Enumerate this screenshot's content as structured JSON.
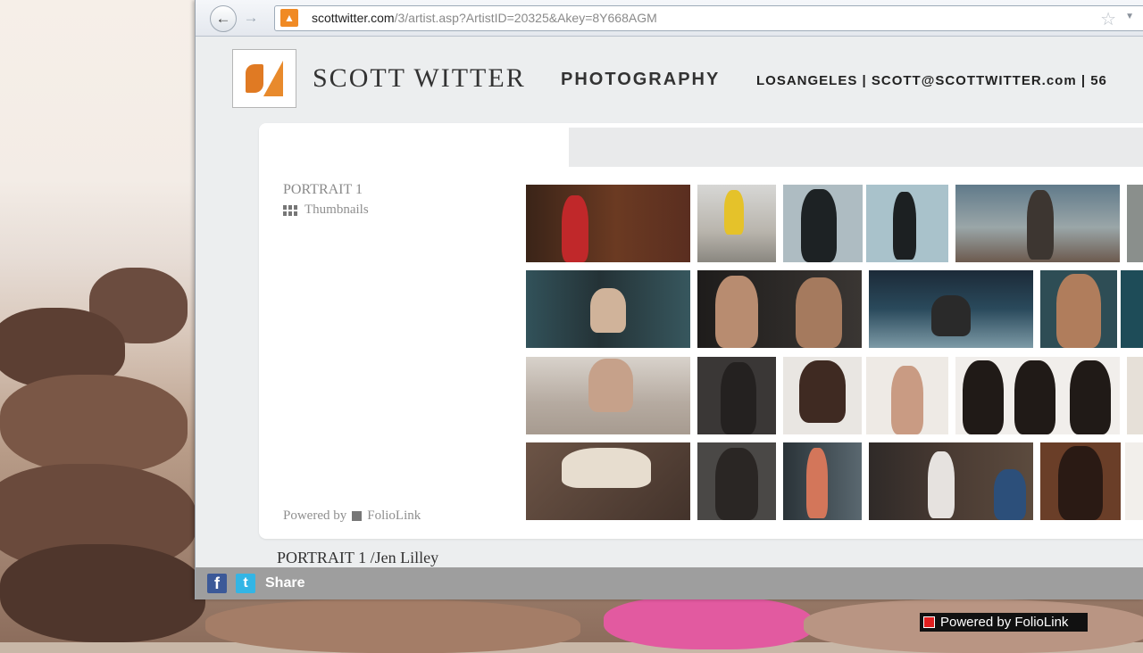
{
  "browser": {
    "url_host": "scottwitter.com",
    "url_path": "/3/artist.asp?ArtistID=20325&Akey=8Y668AGM"
  },
  "header": {
    "title": "SCOTT WITTER",
    "subtitle": "PHOTOGRAPHY",
    "contact": "LOSANGELES | SCOTT@SCOTTWITTER.com | 56"
  },
  "sidebar": {
    "gallery_title": "PORTRAIT 1",
    "thumbnails_label": "Thumbnails",
    "powered_prefix": "Powered by",
    "powered_brand": "FolioLink"
  },
  "caption": "PORTRAIT 1 /Jen Lilley",
  "share": {
    "label": "Share"
  },
  "badge": {
    "text": "Powered by FolioLink"
  },
  "colors": {
    "accent": "#e07a23",
    "facebook": "#3b5998",
    "twitter": "#33b5e5"
  }
}
